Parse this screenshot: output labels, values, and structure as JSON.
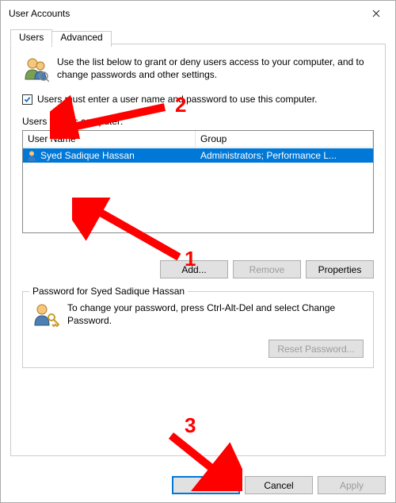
{
  "window": {
    "title": "User Accounts"
  },
  "tabs": {
    "users": "Users",
    "advanced": "Advanced"
  },
  "intro": "Use the list below to grant or deny users access to your computer, and to change passwords and other settings.",
  "checkbox": {
    "label": "Users must enter a user name and password to use this computer.",
    "checked": true
  },
  "list": {
    "caption": "Users for this computer:",
    "cols": {
      "user": "User Name",
      "group": "Group"
    },
    "rows": [
      {
        "user": "Syed Sadique Hassan",
        "group": "Administrators; Performance L..."
      }
    ]
  },
  "buttons": {
    "add": "Add...",
    "remove": "Remove",
    "properties": "Properties",
    "reset": "Reset Password...",
    "ok": "OK",
    "cancel": "Cancel",
    "apply": "Apply"
  },
  "password_box": {
    "legend": "Password for Syed Sadique Hassan",
    "text": "To change your password, press Ctrl-Alt-Del and select Change Password."
  },
  "annotations": {
    "a1": "1",
    "a2": "2",
    "a3": "3"
  }
}
